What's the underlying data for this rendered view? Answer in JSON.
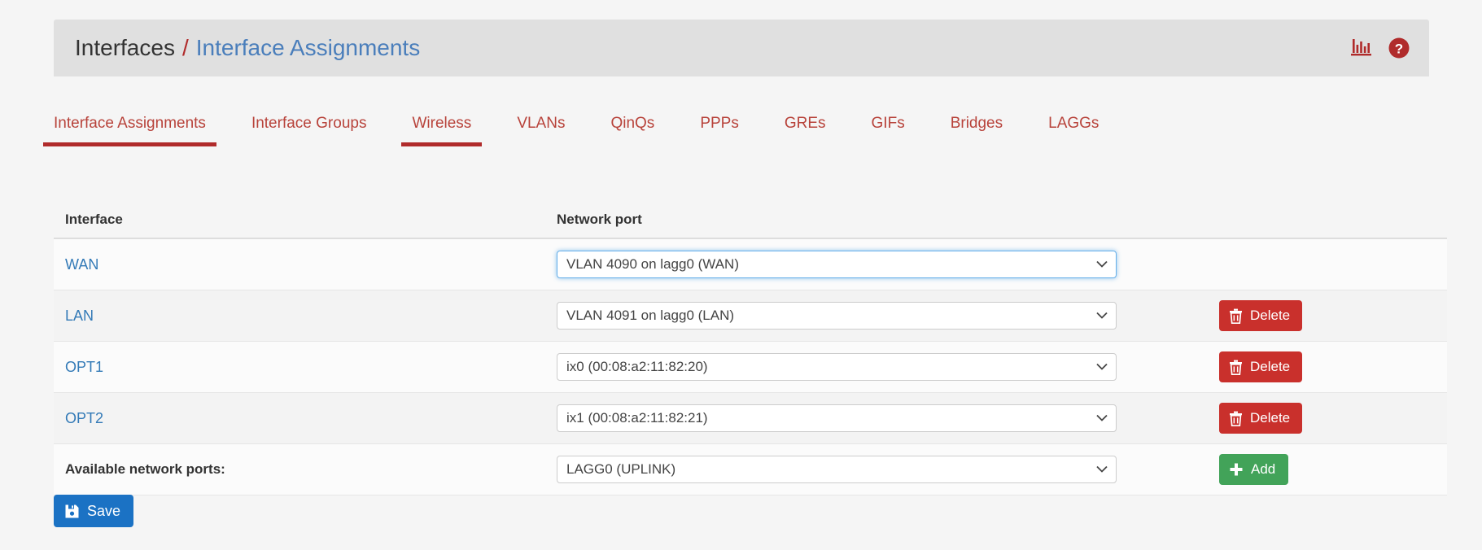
{
  "header": {
    "breadcrumb_root": "Interfaces",
    "breadcrumb_separator": "/",
    "breadcrumb_current": "Interface Assignments",
    "icons": [
      {
        "name": "status-chart-icon",
        "label": "Status Monitoring"
      },
      {
        "name": "help-icon",
        "label": "Help"
      }
    ],
    "accent_color": "#b02b2b",
    "link_color": "#337ab7"
  },
  "tabs": [
    {
      "label": "Interface Assignments",
      "active": true,
      "underlined": true
    },
    {
      "label": "Interface Groups",
      "active": false,
      "underlined": false
    },
    {
      "label": "Wireless",
      "active": false,
      "underlined": true
    },
    {
      "label": "VLANs",
      "active": false,
      "underlined": false
    },
    {
      "label": "QinQs",
      "active": false,
      "underlined": false
    },
    {
      "label": "PPPs",
      "active": false,
      "underlined": false
    },
    {
      "label": "GREs",
      "active": false,
      "underlined": false
    },
    {
      "label": "GIFs",
      "active": false,
      "underlined": false
    },
    {
      "label": "Bridges",
      "active": false,
      "underlined": false
    },
    {
      "label": "LAGGs",
      "active": false,
      "underlined": false
    }
  ],
  "table": {
    "columns": {
      "interface": "Interface",
      "network_port": "Network port"
    },
    "rows": [
      {
        "interface": "WAN",
        "port": "VLAN 4090 on lagg0 (WAN)",
        "focused": true,
        "has_delete": false,
        "delete_label": "Delete"
      },
      {
        "interface": "LAN",
        "port": "VLAN 4091 on lagg0 (LAN)",
        "focused": false,
        "has_delete": true,
        "delete_label": "Delete"
      },
      {
        "interface": "OPT1",
        "port": "ix0 (00:08:a2:11:82:20)",
        "focused": false,
        "has_delete": true,
        "delete_label": "Delete"
      },
      {
        "interface": "OPT2",
        "port": "ix1 (00:08:a2:11:82:21)",
        "focused": false,
        "has_delete": true,
        "delete_label": "Delete"
      }
    ],
    "available": {
      "label": "Available network ports:",
      "port": "LAGG0 (UPLINK)",
      "add_label": "Add"
    }
  },
  "footer": {
    "save_label": "Save"
  }
}
